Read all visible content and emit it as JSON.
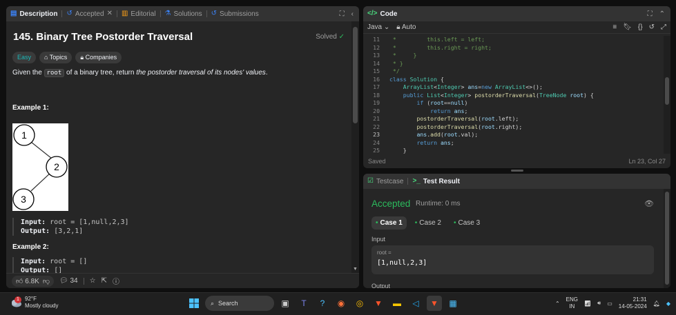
{
  "left_tabs": [
    {
      "label": "Description",
      "icon": "description-icon"
    },
    {
      "label": "Accepted",
      "icon": "history-icon"
    },
    {
      "label": "Editorial",
      "icon": "book-icon"
    },
    {
      "label": "Solutions",
      "icon": "flask-icon"
    },
    {
      "label": "Submissions",
      "icon": "history-icon"
    }
  ],
  "problem": {
    "title": "145. Binary Tree Postorder Traversal",
    "solved_label": "Solved",
    "tags": {
      "difficulty": "Easy",
      "topics": "Topics",
      "companies": "Companies"
    },
    "desc_pre": "Given the ",
    "desc_code": "root",
    "desc_mid": " of a binary tree, return ",
    "desc_em": "the postorder traversal of its nodes' values",
    "desc_post": ".",
    "example1_title": "Example 1:",
    "tree_nodes": [
      "1",
      "2",
      "3"
    ],
    "example1_input_label": "Input:",
    "example1_input": "root = [1,null,2,3]",
    "example1_output_label": "Output:",
    "example1_output": "[3,2,1]",
    "example2_title": "Example 2:",
    "example2_input_label": "Input:",
    "example2_input": "root = []",
    "example2_output_label": "Output:",
    "example2_output": "[]"
  },
  "left_footer": {
    "likes": "6.8K",
    "comments": "34"
  },
  "code_panel": {
    "tab_label": "Code",
    "language": "Java",
    "mode": "Auto",
    "status_left": "Saved",
    "status_right": "Ln 23, Col 27",
    "current_line": 23,
    "lines": [
      {
        "n": "11",
        "t": " *         this.left = left;"
      },
      {
        "n": "12",
        "t": " *         this.right = right;"
      },
      {
        "n": "13",
        "t": " *     }"
      },
      {
        "n": "14",
        "t": " * }"
      },
      {
        "n": "15",
        "t": " */"
      },
      {
        "n": "16",
        "t": "class Solution {"
      },
      {
        "n": "17",
        "t": "    ArrayList<Integer> ans=new ArrayList<>();"
      },
      {
        "n": "18",
        "t": "    public List<Integer> postorderTraversal(TreeNode root) {"
      },
      {
        "n": "19",
        "t": "        if (root==null)"
      },
      {
        "n": "20",
        "t": "            return ans;"
      },
      {
        "n": "21",
        "t": "        postorderTraversal(root.left);"
      },
      {
        "n": "22",
        "t": "        postorderTraversal(root.right);"
      },
      {
        "n": "23",
        "t": "        ans.add(root.val);"
      },
      {
        "n": "24",
        "t": "        return ans;"
      },
      {
        "n": "25",
        "t": "    }"
      }
    ]
  },
  "test_panel": {
    "tab_testcase": "Testcase",
    "tab_result": "Test Result",
    "status": "Accepted",
    "runtime": "Runtime: 0 ms",
    "cases": [
      "Case 1",
      "Case 2",
      "Case 3"
    ],
    "input_label": "Input",
    "var_name": "root =",
    "var_value": "[1,null,2,3]",
    "output_label": "Output"
  },
  "taskbar": {
    "temperature": "92°F",
    "weather": "Mostly cloudy",
    "weather_badge": "1",
    "search_label": "Search",
    "lang_top": "ENG",
    "lang_bottom": "IN",
    "time": "21:31",
    "date": "14-05-2024"
  },
  "colors": {
    "accent_green": "#2cbb5d",
    "easy": "#1cbaba",
    "panel": "#262626",
    "background": "#0f0f0f"
  }
}
